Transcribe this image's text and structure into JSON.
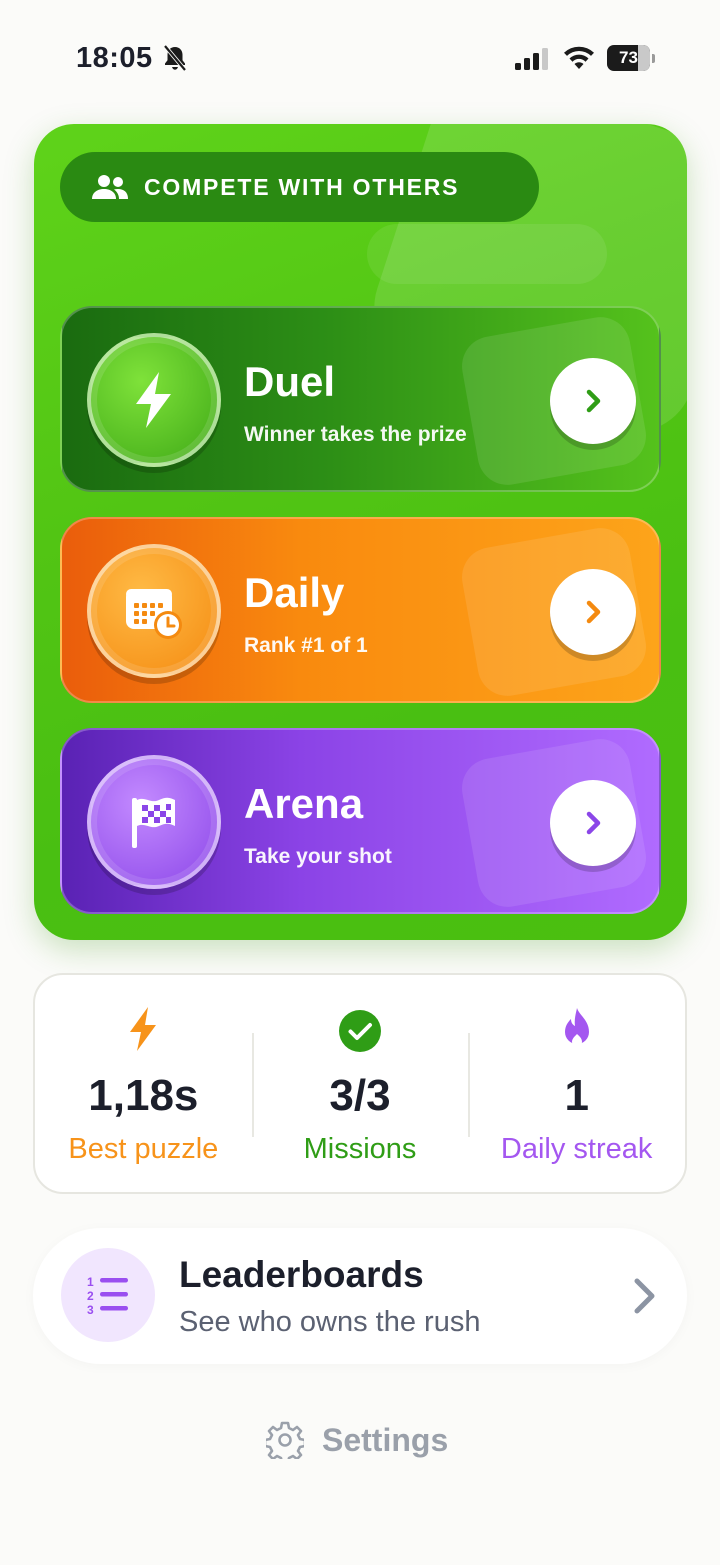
{
  "status_bar": {
    "time": "18:05",
    "battery": "73",
    "battery_level_percent": 73,
    "icons": [
      "bell-slash-icon",
      "signal-icon",
      "wifi-icon",
      "battery-icon"
    ]
  },
  "compete": {
    "header_label": "COMPETE WITH OTHERS",
    "header_icon": "users-icon",
    "modes": [
      {
        "title": "Duel",
        "subtitle": "Winner takes the prize",
        "icon": "lightning-icon",
        "accent": "#3ea816"
      },
      {
        "title": "Daily",
        "subtitle": "Rank #1 of 1",
        "icon": "calendar-clock-icon",
        "accent": "#f48a10"
      },
      {
        "title": "Arena",
        "subtitle": "Take your shot",
        "icon": "checkered-flag-icon",
        "accent": "#8b46e8"
      }
    ]
  },
  "stats": {
    "best_puzzle": {
      "value": "1,18s",
      "label": "Best puzzle",
      "color": "#f7931a"
    },
    "missions": {
      "value": "3/3",
      "label": "Missions",
      "color": "#2f9d16"
    },
    "daily_streak": {
      "value": "1",
      "label": "Daily streak",
      "color": "#a457f0"
    }
  },
  "leaderboards": {
    "title": "Leaderboards",
    "subtitle": "See who owns the rush",
    "icon": "numbered-list-icon"
  },
  "settings": {
    "label": "Settings",
    "icon": "gear-icon"
  }
}
